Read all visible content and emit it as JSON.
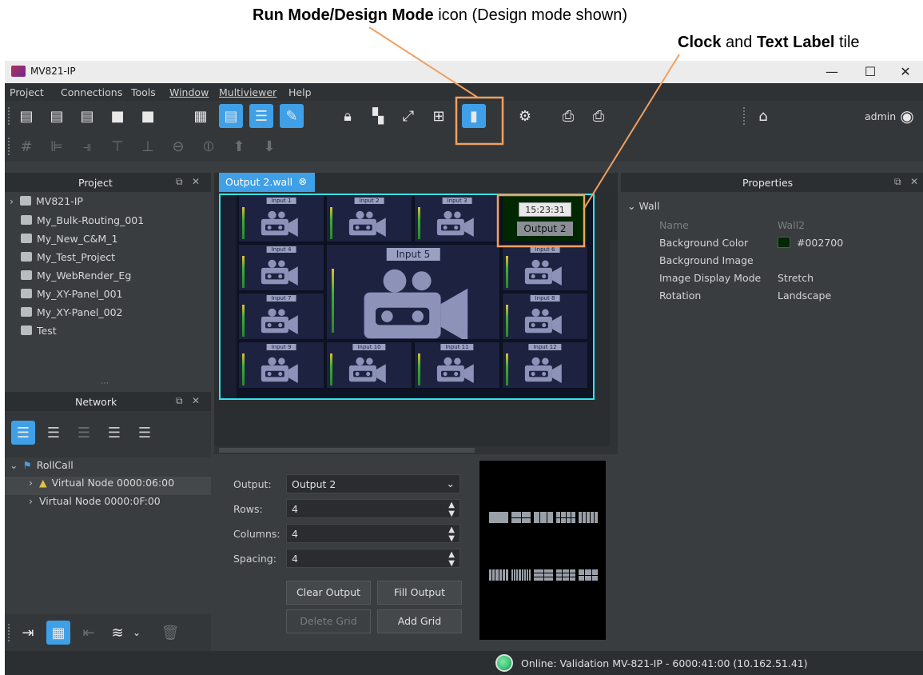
{
  "annotations": {
    "run_mode_bold": "Run Mode/Design Mode",
    "run_mode_rest": " icon (Design mode shown)",
    "clock_bold": "Clock",
    "clock_and": " and ",
    "text_label_bold": "Text Label",
    "tile_word": " tile"
  },
  "window": {
    "title": "MV821-IP",
    "minimize": "—",
    "maximize": "☐",
    "close": "✕"
  },
  "menu": [
    "Project",
    "Connections",
    "Tools",
    "Window",
    "Multiviewer",
    "Help"
  ],
  "toolbar": {
    "user": "admin"
  },
  "project_panel": {
    "title": "Project",
    "items": [
      "MV821-IP",
      "My_Bulk-Routing_001",
      "My_New_C&M_1",
      "My_Test_Project",
      "My_WebRender_Eg",
      "My_XY-Panel_001",
      "My_XY-Panel_002",
      "Test"
    ]
  },
  "network_panel": {
    "title": "Network",
    "root": "RollCall",
    "nodes": [
      "Virtual Node 0000:06:00",
      "Virtual Node 0000:0F:00"
    ]
  },
  "editor": {
    "tab_label": "Output 2.wall",
    "clock_time": "15:23:31",
    "text_label": "Output 2",
    "big_tile_label": "Input 5",
    "small_labels": [
      "Input 1",
      "Input 2",
      "Input 3",
      "Input 4",
      "Input 6",
      "Input 7",
      "Input 8",
      "Input 9",
      "Input 10",
      "Input 11",
      "Input 12"
    ]
  },
  "grid_controls": {
    "output_label": "Output:",
    "output_value": "Output 2",
    "rows_label": "Rows:",
    "rows_value": "4",
    "columns_label": "Columns:",
    "columns_value": "4",
    "spacing_label": "Spacing:",
    "spacing_value": "4",
    "clear_output": "Clear Output",
    "fill_output": "Fill Output",
    "delete_grid": "Delete Grid",
    "add_grid": "Add Grid"
  },
  "properties": {
    "title": "Properties",
    "section": "Wall",
    "rows": [
      {
        "label": "Name",
        "value": "Wall2"
      },
      {
        "label": "Background Color",
        "value": "#002700"
      },
      {
        "label": "Background Image",
        "value": ""
      },
      {
        "label": "Image Display Mode",
        "value": "Stretch"
      },
      {
        "label": "Rotation",
        "value": "Landscape"
      }
    ]
  },
  "status": {
    "text": "Online: Validation MV-821-IP - 6000:41:00 (10.162.51.41)",
    "indicator_color": "#3ec878"
  },
  "colors": {
    "accent": "#3fa0e8",
    "highlight_box": "#2ee6f0",
    "callout_line": "#f0a060",
    "wall_bg": "#002700"
  }
}
